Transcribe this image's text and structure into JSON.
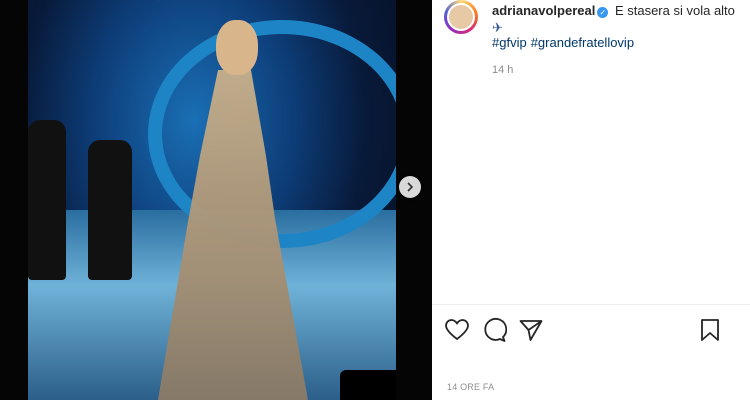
{
  "post": {
    "username": "adrianavolpereal",
    "caption": "E stasera si vola alto",
    "hashtags": [
      "#gfvip",
      "#grandefratellovip"
    ],
    "time_short": "14 h",
    "time_long": "14 ORE FA"
  },
  "icons": {
    "verified": "verified-badge-icon",
    "plane": "airplane-emoji-icon",
    "like": "heart-icon",
    "comment": "comment-icon",
    "share": "paper-plane-icon",
    "save": "bookmark-icon",
    "next": "chevron-right-icon"
  },
  "colors": {
    "link": "#00376b",
    "verified": "#3897f0",
    "text": "#262626",
    "muted": "#8e8e8e"
  }
}
